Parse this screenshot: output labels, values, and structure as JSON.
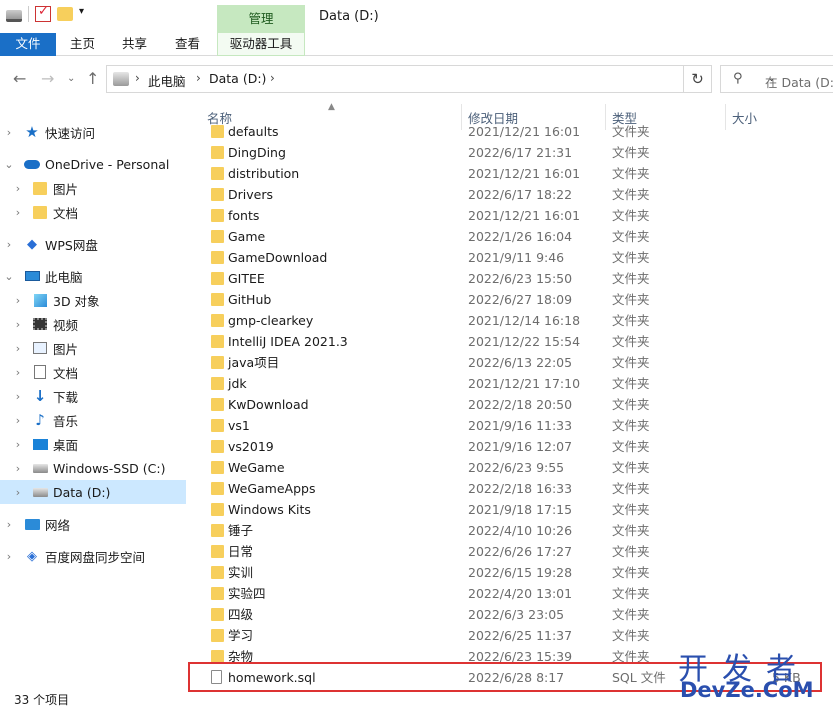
{
  "window": {
    "title": "Data (D:)",
    "manage_tab": "管理"
  },
  "ribbon": {
    "file": "文件",
    "home": "主页",
    "share": "共享",
    "view": "查看",
    "drive_tools": "驱动器工具"
  },
  "address": {
    "crumbs": [
      "此电脑",
      "Data (D:)"
    ]
  },
  "search": {
    "placeholder": "在 Data (D:)"
  },
  "sidebar": {
    "items": [
      {
        "label": "快速访问",
        "icon": "star-icon"
      },
      {
        "label": "OneDrive - Personal",
        "icon": "cloud-icon"
      },
      {
        "label": "图片",
        "icon": "folder-icon"
      },
      {
        "label": "文档",
        "icon": "folder-icon"
      },
      {
        "label": "WPS网盘",
        "icon": "wps-cloud-icon"
      },
      {
        "label": "此电脑",
        "icon": "computer-icon"
      },
      {
        "label": "3D 对象",
        "icon": "3d-objects-icon"
      },
      {
        "label": "视频",
        "icon": "video-icon"
      },
      {
        "label": "图片",
        "icon": "pictures-icon"
      },
      {
        "label": "文档",
        "icon": "documents-icon"
      },
      {
        "label": "下载",
        "icon": "download-icon"
      },
      {
        "label": "音乐",
        "icon": "music-icon"
      },
      {
        "label": "桌面",
        "icon": "desktop-icon"
      },
      {
        "label": "Windows-SSD (C:)",
        "icon": "drive-icon"
      },
      {
        "label": "Data (D:)",
        "icon": "drive-icon"
      },
      {
        "label": "网络",
        "icon": "network-icon"
      },
      {
        "label": "百度网盘同步空间",
        "icon": "baidu-sync-icon"
      }
    ],
    "selected": "Data (D:)"
  },
  "columns": {
    "name": "名称",
    "date": "修改日期",
    "type": "类型",
    "size": "大小"
  },
  "files": [
    {
      "name": "defaults",
      "date": "2021/12/21 16:01",
      "type": "文件夹",
      "size": "",
      "kind": "folder"
    },
    {
      "name": "DingDing",
      "date": "2022/6/17 21:31",
      "type": "文件夹",
      "size": "",
      "kind": "folder"
    },
    {
      "name": "distribution",
      "date": "2021/12/21 16:01",
      "type": "文件夹",
      "size": "",
      "kind": "folder"
    },
    {
      "name": "Drivers",
      "date": "2022/6/17 18:22",
      "type": "文件夹",
      "size": "",
      "kind": "folder"
    },
    {
      "name": "fonts",
      "date": "2021/12/21 16:01",
      "type": "文件夹",
      "size": "",
      "kind": "folder"
    },
    {
      "name": "Game",
      "date": "2022/1/26 16:04",
      "type": "文件夹",
      "size": "",
      "kind": "folder"
    },
    {
      "name": "GameDownload",
      "date": "2021/9/11 9:46",
      "type": "文件夹",
      "size": "",
      "kind": "folder"
    },
    {
      "name": "GITEE",
      "date": "2022/6/23 15:50",
      "type": "文件夹",
      "size": "",
      "kind": "folder"
    },
    {
      "name": "GitHub",
      "date": "2022/6/27 18:09",
      "type": "文件夹",
      "size": "",
      "kind": "folder"
    },
    {
      "name": "gmp-clearkey",
      "date": "2021/12/14 16:18",
      "type": "文件夹",
      "size": "",
      "kind": "folder"
    },
    {
      "name": "IntelliJ IDEA 2021.3",
      "date": "2021/12/22 15:54",
      "type": "文件夹",
      "size": "",
      "kind": "folder"
    },
    {
      "name": "java项目",
      "date": "2022/6/13 22:05",
      "type": "文件夹",
      "size": "",
      "kind": "folder"
    },
    {
      "name": "jdk",
      "date": "2021/12/21 17:10",
      "type": "文件夹",
      "size": "",
      "kind": "folder"
    },
    {
      "name": "KwDownload",
      "date": "2022/2/18 20:50",
      "type": "文件夹",
      "size": "",
      "kind": "folder"
    },
    {
      "name": "vs1",
      "date": "2021/9/16 11:33",
      "type": "文件夹",
      "size": "",
      "kind": "folder"
    },
    {
      "name": "vs2019",
      "date": "2021/9/16 12:07",
      "type": "文件夹",
      "size": "",
      "kind": "folder"
    },
    {
      "name": "WeGame",
      "date": "2022/6/23 9:55",
      "type": "文件夹",
      "size": "",
      "kind": "folder"
    },
    {
      "name": "WeGameApps",
      "date": "2022/2/18 16:33",
      "type": "文件夹",
      "size": "",
      "kind": "folder"
    },
    {
      "name": "Windows Kits",
      "date": "2021/9/18 17:15",
      "type": "文件夹",
      "size": "",
      "kind": "folder"
    },
    {
      "name": "锤子",
      "date": "2022/4/10 10:26",
      "type": "文件夹",
      "size": "",
      "kind": "folder"
    },
    {
      "name": "日常",
      "date": "2022/6/26 17:27",
      "type": "文件夹",
      "size": "",
      "kind": "folder"
    },
    {
      "name": "实训",
      "date": "2022/6/15 19:28",
      "type": "文件夹",
      "size": "",
      "kind": "folder"
    },
    {
      "name": "实验四",
      "date": "2022/4/20 13:01",
      "type": "文件夹",
      "size": "",
      "kind": "folder"
    },
    {
      "name": "四级",
      "date": "2022/6/3 23:05",
      "type": "文件夹",
      "size": "",
      "kind": "folder"
    },
    {
      "name": "学习",
      "date": "2022/6/25 11:37",
      "type": "文件夹",
      "size": "",
      "kind": "folder"
    },
    {
      "name": "杂物",
      "date": "2022/6/23 15:39",
      "type": "文件夹",
      "size": "",
      "kind": "folder"
    },
    {
      "name": "homework.sql",
      "date": "2022/6/28 8:17",
      "type": "SQL 文件",
      "size": "5 KB",
      "kind": "file"
    }
  ],
  "status": "33 个项目",
  "watermark": {
    "line1": "开发者",
    "line2": "DevZe.CoM"
  }
}
